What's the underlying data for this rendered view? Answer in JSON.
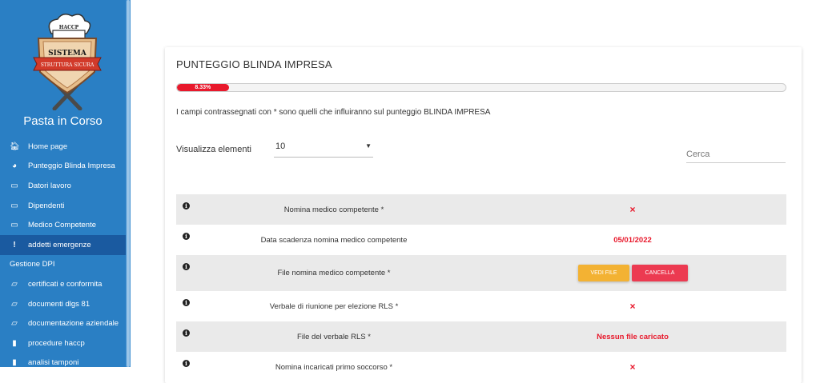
{
  "sidebar": {
    "logo": {
      "hat_text": "HACCP",
      "title_text": "SISTEMA",
      "ribbon_text": "STRUTTURA SICURA"
    },
    "brand_title": "Pasta in Corso",
    "items": [
      {
        "label": "Home page",
        "icon": "home-icon",
        "glyph": "🏠︎"
      },
      {
        "label": "Punteggio Blinda Impresa",
        "icon": "pie-chart-icon",
        "glyph": "◕"
      },
      {
        "label": "Datori lavoro",
        "icon": "id-card-icon",
        "glyph": "▭"
      },
      {
        "label": "Dipendenti",
        "icon": "id-card-icon",
        "glyph": "▭"
      },
      {
        "label": "Medico Competente",
        "icon": "id-card-icon",
        "glyph": "▭"
      },
      {
        "label": "addetti emergenze",
        "icon": "exclamation-icon",
        "glyph": "!"
      },
      {
        "label": "Gestione DPI",
        "icon": "",
        "glyph": ""
      },
      {
        "label": "certificati e conformita",
        "icon": "folder-open-icon",
        "glyph": "▱"
      },
      {
        "label": "documenti dlgs 81",
        "icon": "folder-open-icon",
        "glyph": "▱"
      },
      {
        "label": "documentazione aziendale",
        "icon": "folder-open-icon",
        "glyph": "▱"
      },
      {
        "label": "procedure haccp",
        "icon": "clipboard-icon",
        "glyph": "▮"
      },
      {
        "label": "analisi tamponi",
        "icon": "clipboard-icon",
        "glyph": "▮"
      }
    ],
    "active_index": 5
  },
  "card": {
    "title": "PUNTEGGIO BLINDA IMPRESA",
    "progress_label": "8.33%",
    "progress_value": 0.0833,
    "note": "I campi contrassegnati con * sono quelli che influiranno sul punteggio BLINDA IMPRESA",
    "show_label": "Visualizza elementi",
    "page_size": "10",
    "search_placeholder": "Cerca"
  },
  "rows": [
    {
      "label": "Nomina medico competente *",
      "value": "×",
      "kind": "cross"
    },
    {
      "label": "Data scadenza nomina medico competente",
      "value": "05/01/2022",
      "kind": "text"
    },
    {
      "label": "File nomina medico competente *",
      "kind": "buttons",
      "btn_view": "VEDI FILE",
      "btn_delete": "CANCELLA"
    },
    {
      "label": "Verbale di riunione per elezione RLS *",
      "value": "×",
      "kind": "cross"
    },
    {
      "label": "File del verbale RLS *",
      "value": "Nessun file caricato",
      "kind": "text"
    },
    {
      "label": "Nomina incaricati primo soccorso *",
      "value": "×",
      "kind": "cross"
    }
  ],
  "colors": {
    "sidebar": "#2a7fc4",
    "active": "#1a5aa0",
    "danger": "#e8192c",
    "warning": "#f3b233"
  }
}
